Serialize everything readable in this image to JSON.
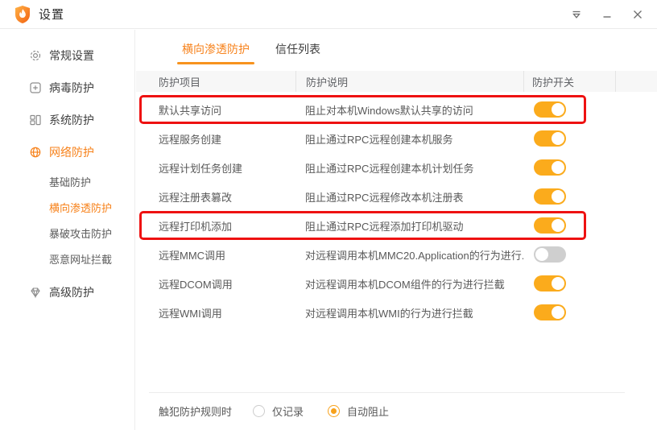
{
  "titlebar": {
    "title": "设置",
    "icons": [
      "app-logo-shield-flame",
      "menu-icon",
      "minimize-icon",
      "close-icon"
    ]
  },
  "sidebar": {
    "items": [
      {
        "label": "常规设置",
        "icon": "gear-icon",
        "level": 0,
        "active": false
      },
      {
        "label": "病毒防护",
        "icon": "plus-square-icon",
        "level": 0,
        "active": false
      },
      {
        "label": "系统防护",
        "icon": "panels-icon",
        "level": 0,
        "active": false
      },
      {
        "label": "网络防护",
        "icon": "globe-icon",
        "level": 0,
        "active": true
      },
      {
        "label": "基础防护",
        "icon": null,
        "level": 1,
        "active": false
      },
      {
        "label": "横向渗透防护",
        "icon": null,
        "level": 1,
        "active": true
      },
      {
        "label": "暴破攻击防护",
        "icon": null,
        "level": 1,
        "active": false
      },
      {
        "label": "恶意网址拦截",
        "icon": null,
        "level": 1,
        "active": false
      },
      {
        "label": "高级防护",
        "icon": "diamond-icon",
        "level": 0,
        "active": false
      }
    ]
  },
  "tabs": [
    {
      "label": "横向渗透防护",
      "active": true
    },
    {
      "label": "信任列表",
      "active": false
    }
  ],
  "table": {
    "columns": [
      "防护项目",
      "防护说明",
      "防护开关"
    ],
    "rows": [
      {
        "name": "默认共享访问",
        "desc": "阻止对本机Windows默认共享的访问",
        "on": true,
        "highlighted": true
      },
      {
        "name": "远程服务创建",
        "desc": "阻止通过RPC远程创建本机服务",
        "on": true,
        "highlighted": false
      },
      {
        "name": "远程计划任务创建",
        "desc": "阻止通过RPC远程创建本机计划任务",
        "on": true,
        "highlighted": false
      },
      {
        "name": "远程注册表篡改",
        "desc": "阻止通过RPC远程修改本机注册表",
        "on": true,
        "highlighted": false
      },
      {
        "name": "远程打印机添加",
        "desc": "阻止通过RPC远程添加打印机驱动",
        "on": true,
        "highlighted": true
      },
      {
        "name": "远程MMC调用",
        "desc": "对远程调用本机MMC20.Application的行为进行...",
        "on": false,
        "highlighted": false
      },
      {
        "name": "远程DCOM调用",
        "desc": "对远程调用本机DCOM组件的行为进行拦截",
        "on": true,
        "highlighted": false
      },
      {
        "name": "远程WMI调用",
        "desc": "对远程调用本机WMI的行为进行拦截",
        "on": true,
        "highlighted": false
      }
    ]
  },
  "footer": {
    "label": "触犯防护规则时",
    "options": [
      {
        "label": "仅记录",
        "selected": false
      },
      {
        "label": "自动阻止",
        "selected": true
      }
    ]
  },
  "colors": {
    "accent_orange": "#f7821b",
    "toggle_on": "#fbab1c",
    "toggle_off": "#cfcfcf",
    "highlight_red": "#ee1111",
    "header_bg": "#f7f7f7"
  }
}
